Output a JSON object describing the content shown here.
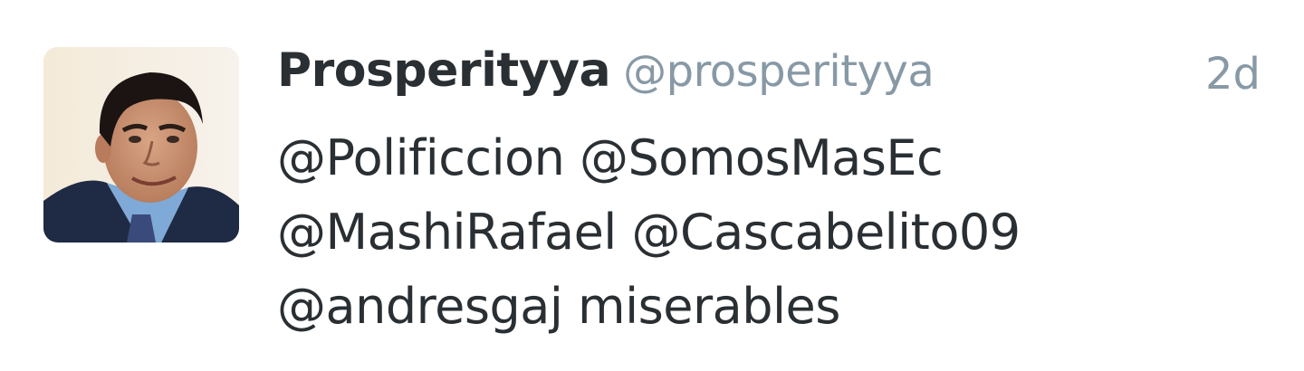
{
  "tweet": {
    "author": {
      "display_name": "Prosperityya",
      "handle": "@prosperityya",
      "avatar_icon": "user-avatar-photo"
    },
    "timestamp": "2d",
    "text_lines": [
      "@Polificcion @SomosMasEc",
      "@MashiRafael @Cascabelito09",
      "@andresgaj miserables"
    ]
  },
  "colors": {
    "text_primary": "#292f33",
    "text_secondary": "#8899a6",
    "background": "#ffffff"
  }
}
